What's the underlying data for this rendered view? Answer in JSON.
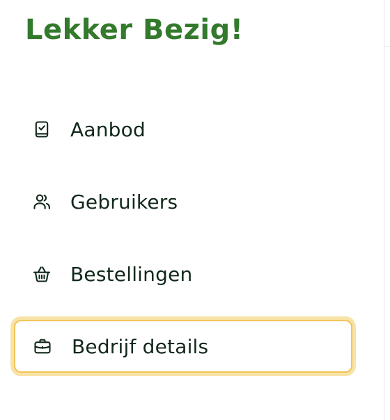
{
  "brand": {
    "title": "Lekker Bezig!",
    "color": "#337a2c"
  },
  "nav": {
    "items": [
      {
        "label": "Aanbod",
        "icon": "checklist-book-icon",
        "active": false
      },
      {
        "label": "Gebruikers",
        "icon": "users-icon",
        "active": false
      },
      {
        "label": "Bestellingen",
        "icon": "basket-icon",
        "active": false
      },
      {
        "label": "Bedrijf details",
        "icon": "briefcase-icon",
        "active": true
      }
    ]
  },
  "colors": {
    "text": "#11281a",
    "active_border": "#f2c45a",
    "active_glow": "#f8e3a6"
  }
}
